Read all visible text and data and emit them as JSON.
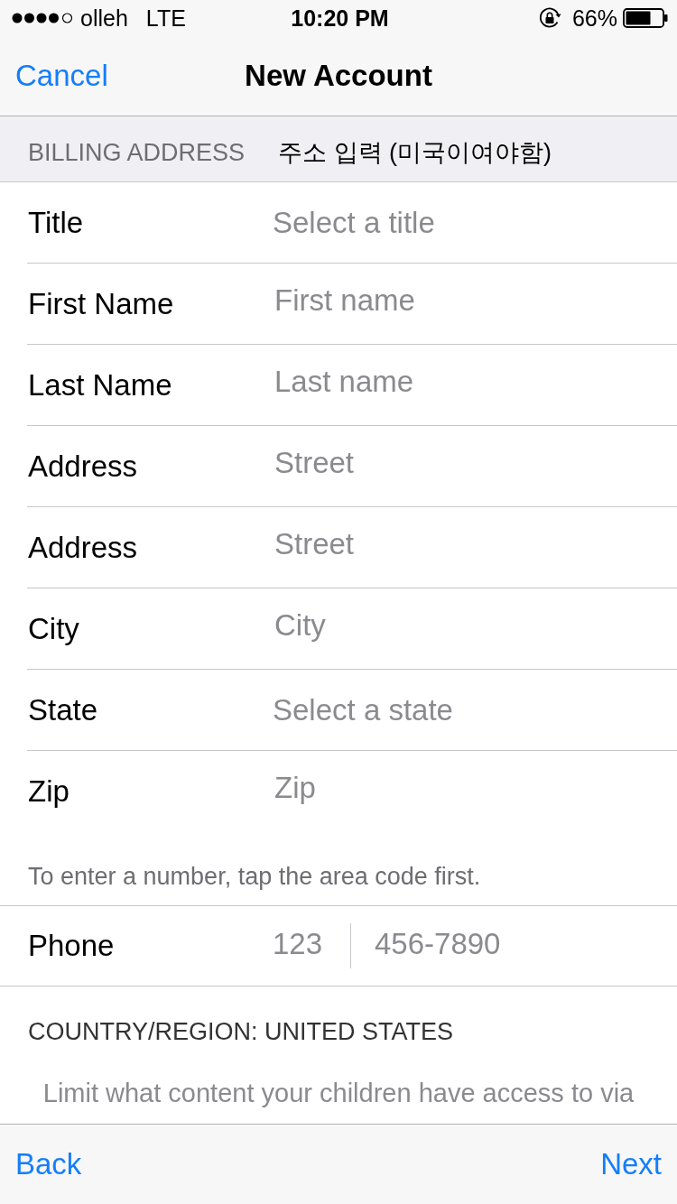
{
  "status_bar": {
    "carrier": "olleh",
    "network": "LTE",
    "time": "10:20 PM",
    "battery": "66%"
  },
  "nav_bar": {
    "left_button": "Cancel",
    "title": "New Account"
  },
  "billing_section": {
    "header": "BILLING ADDRESS",
    "note": "주소 입력 (미국이여야함)",
    "fields": [
      {
        "label": "Title",
        "placeholder": "Select a title",
        "kind": "picker"
      },
      {
        "label": "First Name",
        "placeholder": "First name",
        "kind": "text"
      },
      {
        "label": "Last Name",
        "placeholder": "Last name",
        "kind": "text"
      },
      {
        "label": "Address",
        "placeholder": "Street",
        "kind": "text"
      },
      {
        "label": "Address",
        "placeholder": "Street",
        "kind": "text"
      },
      {
        "label": "City",
        "placeholder": "City",
        "kind": "text"
      },
      {
        "label": "State",
        "placeholder": "Select a state",
        "kind": "picker"
      },
      {
        "label": "Zip",
        "placeholder": "Zip",
        "kind": "text"
      }
    ],
    "footer": "To enter a number, tap the area code first."
  },
  "phone": {
    "label": "Phone",
    "area_code_placeholder": "123",
    "number_placeholder": "456-7890"
  },
  "country_region": "COUNTRY/REGION: UNITED STATES",
  "parental_note": "Limit what content your children have access to via",
  "toolbar": {
    "back": "Back",
    "next": "Next"
  }
}
